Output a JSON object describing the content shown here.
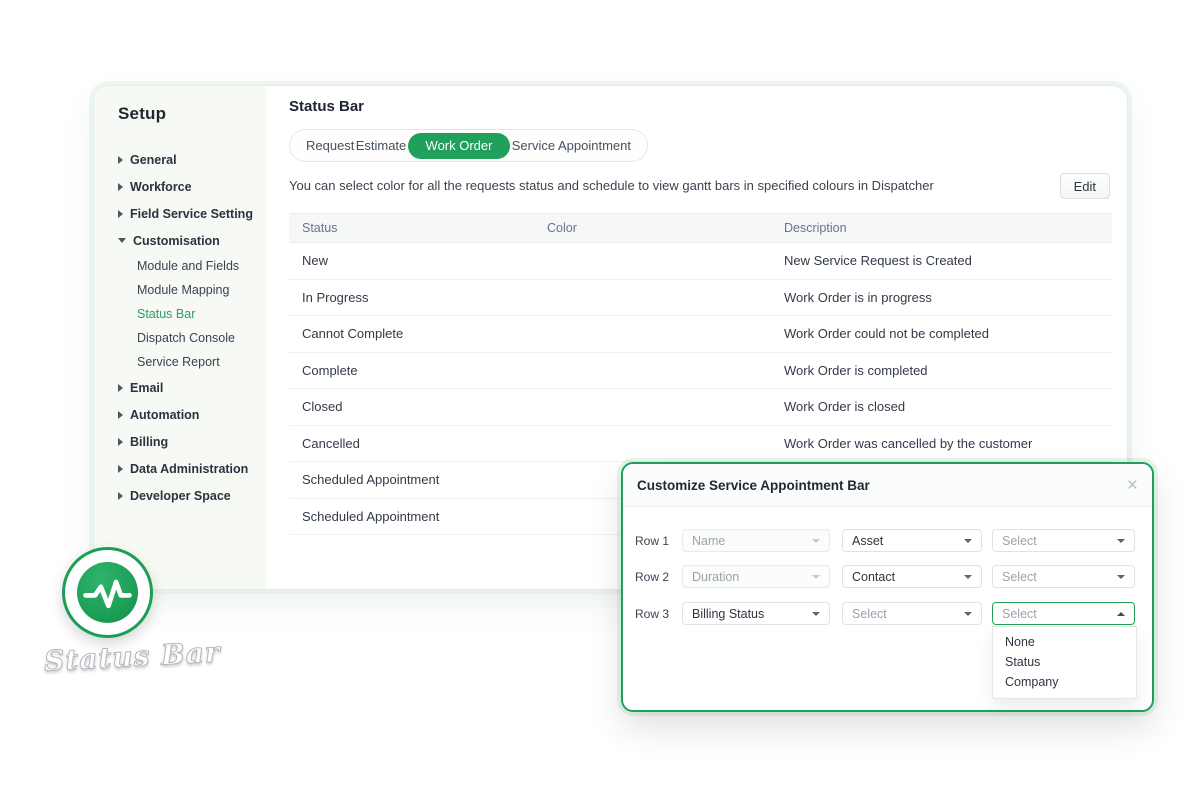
{
  "accent": {
    "green": "#20a05b",
    "modal_border": "#1fa058"
  },
  "sidebar": {
    "title": "Setup",
    "items": [
      {
        "label": "General"
      },
      {
        "label": "Workforce"
      },
      {
        "label": "Field Service Setting"
      },
      {
        "label": "Customisation",
        "expanded": true,
        "children": [
          {
            "label": "Module and Fields"
          },
          {
            "label": "Module Mapping"
          },
          {
            "label": "Status Bar",
            "active": true
          },
          {
            "label": "Dispatch Console"
          },
          {
            "label": "Service Report"
          }
        ]
      },
      {
        "label": "Email"
      },
      {
        "label": "Automation"
      },
      {
        "label": "Billing"
      },
      {
        "label": "Data Administration"
      },
      {
        "label": "Developer Space"
      }
    ]
  },
  "main": {
    "title": "Status Bar",
    "tabs": [
      {
        "label": "Request"
      },
      {
        "label": "Estimate"
      },
      {
        "label": "Work Order",
        "active": true
      },
      {
        "label": "Service Appointment"
      }
    ],
    "description": "You can select color for all the requests status and schedule to view gantt bars in specified colours in Dispatcher",
    "edit_button": "Edit",
    "table": {
      "headers": [
        "Status",
        "Color",
        "Description"
      ],
      "rows": [
        {
          "status": "New",
          "color": "#ed7470",
          "description": "New Service Request is Created"
        },
        {
          "status": "In Progress",
          "color": "#ed7470",
          "description": "Work Order is in progress"
        },
        {
          "status": "Cannot Complete",
          "color": "#4fba83",
          "description": "Work Order could not be completed"
        },
        {
          "status": "Complete",
          "color": "#4a7e99",
          "description": "Work Order is completed"
        },
        {
          "status": "Closed",
          "color": "#4a7e99",
          "description": "Work Order is closed"
        },
        {
          "status": "Cancelled",
          "color": "#000000",
          "description": "Work Order was cancelled by the customer"
        },
        {
          "status": "Scheduled Appointment",
          "color": "#97b95c",
          "description": ""
        },
        {
          "status": "Scheduled Appointment",
          "color": "#edbb3f",
          "description": ""
        }
      ]
    }
  },
  "modal": {
    "title": "Customize Service Appointment Bar",
    "close_icon": "×",
    "rows": [
      {
        "label": "Row 1",
        "selects": [
          {
            "value": "Name",
            "state": "disabled"
          },
          {
            "value": "Asset",
            "state": "selected"
          },
          {
            "value": "Select",
            "state": "placeholder"
          }
        ]
      },
      {
        "label": "Row 2",
        "selects": [
          {
            "value": "Duration",
            "state": "disabled"
          },
          {
            "value": "Contact",
            "state": "selected"
          },
          {
            "value": "Select",
            "state": "placeholder"
          }
        ]
      },
      {
        "label": "Row 3",
        "selects": [
          {
            "value": "Billing Status",
            "state": "selected"
          },
          {
            "value": "Select",
            "state": "placeholder"
          },
          {
            "value": "Select",
            "state": "open"
          }
        ]
      }
    ],
    "dropdown_options": [
      "None",
      "Status",
      "Company"
    ]
  },
  "badge": {
    "label": "Status Bar"
  }
}
